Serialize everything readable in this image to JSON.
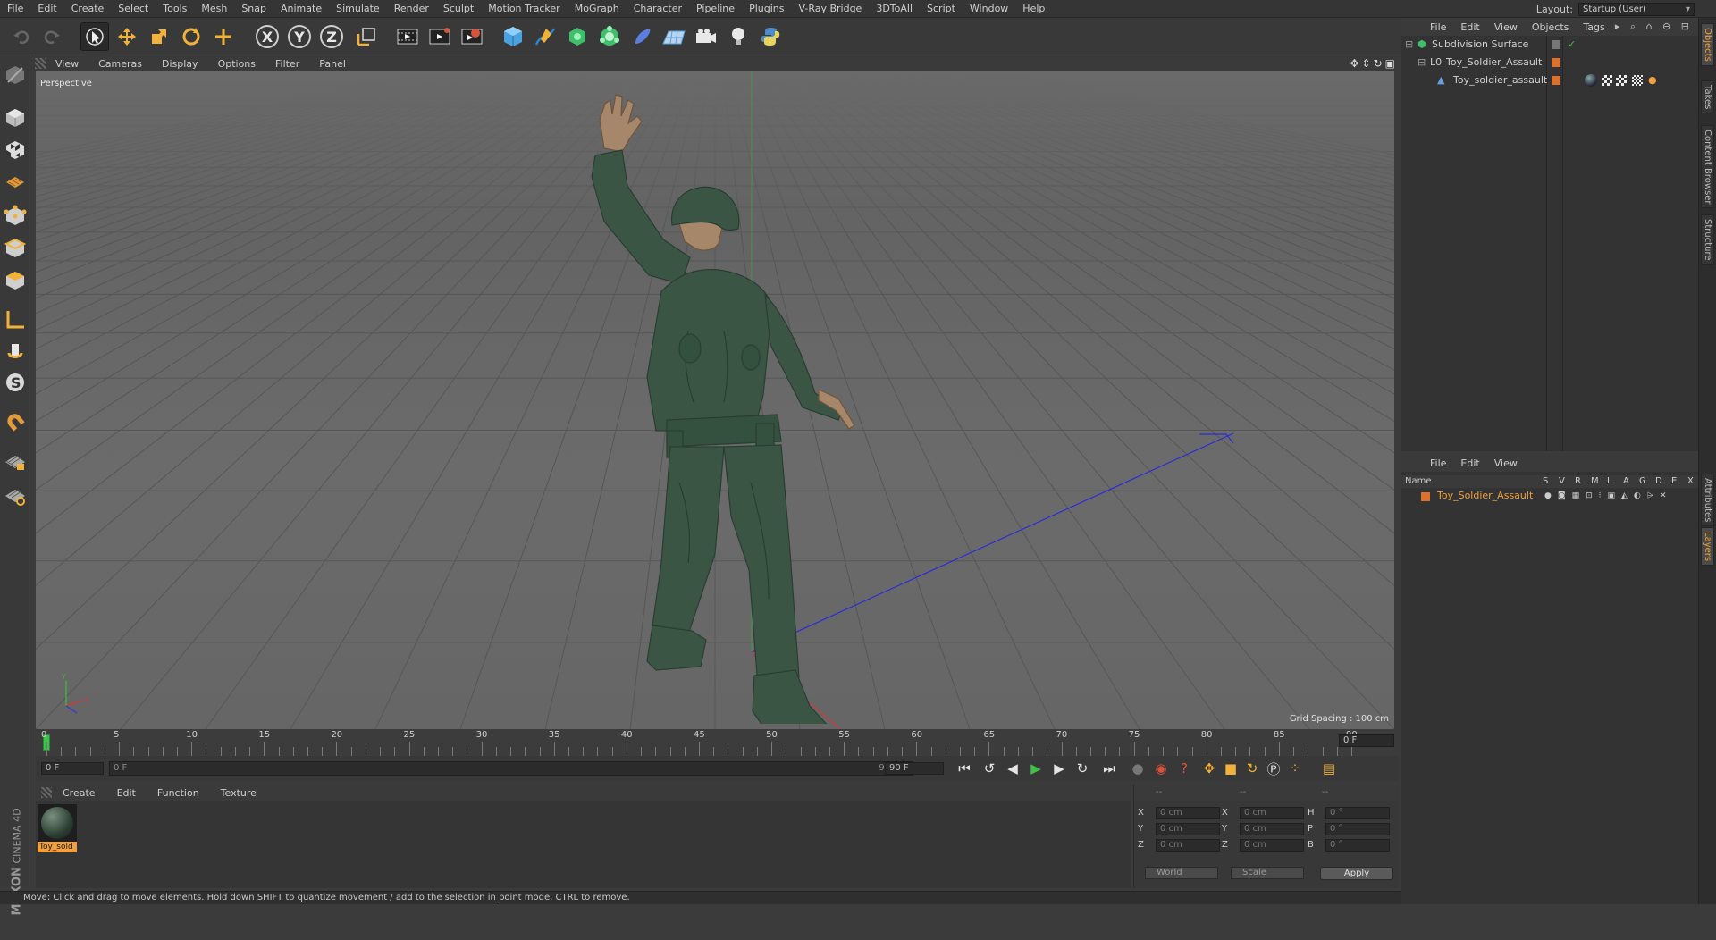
{
  "menubar": {
    "items": [
      "File",
      "Edit",
      "Create",
      "Select",
      "Tools",
      "Mesh",
      "Snap",
      "Animate",
      "Simulate",
      "Render",
      "Sculpt",
      "Motion Tracker",
      "MoGraph",
      "Character",
      "Pipeline",
      "Plugins",
      "V-Ray Bridge",
      "3DToAll",
      "Script",
      "Window",
      "Help"
    ],
    "layout_label": "Layout:",
    "layout_value": "Startup (User)"
  },
  "viewport": {
    "menu": [
      "View",
      "Cameras",
      "Display",
      "Options",
      "Filter",
      "Panel"
    ],
    "label": "Perspective",
    "grid_spacing": "Grid Spacing : 100 cm"
  },
  "timeline": {
    "ticks": [
      "0",
      "5",
      "10",
      "15",
      "20",
      "25",
      "30",
      "35",
      "40",
      "45",
      "50",
      "55",
      "60",
      "65",
      "70",
      "75",
      "80",
      "85",
      "90"
    ],
    "current_frame": "0 F"
  },
  "transport": {
    "start_field": "0 F",
    "range_start": "0 F",
    "range_end": "90 F",
    "end_field": "90 F"
  },
  "material_manager": {
    "menu": [
      "Create",
      "Edit",
      "Function",
      "Texture"
    ],
    "material_name": "Toy_sold"
  },
  "coordinates": {
    "headers": [
      "--",
      "--",
      "--"
    ],
    "rows": [
      {
        "a": "X",
        "av": "0 cm",
        "b": "X",
        "bv": "0 cm",
        "c": "H",
        "cv": "0 °"
      },
      {
        "a": "Y",
        "av": "0 cm",
        "b": "Y",
        "bv": "0 cm",
        "c": "P",
        "cv": "0 °"
      },
      {
        "a": "Z",
        "av": "0 cm",
        "b": "Z",
        "bv": "0 cm",
        "c": "B",
        "cv": "0 °"
      }
    ],
    "mode": "World",
    "scale": "Scale",
    "apply": "Apply"
  },
  "object_manager": {
    "menu": [
      "File",
      "Edit",
      "View",
      "Objects",
      "Tags"
    ],
    "objects": [
      {
        "name": "Subdivision Surface",
        "level": 0
      },
      {
        "name": "Toy_Soldier_Assault",
        "level": 1
      },
      {
        "name": "Toy_soldier_assault",
        "level": 2
      }
    ]
  },
  "layer_manager": {
    "menu": [
      "File",
      "Edit",
      "View"
    ],
    "header_name": "Name",
    "columns": [
      "S",
      "V",
      "R",
      "M",
      "L",
      "A",
      "G",
      "D",
      "E",
      "X"
    ],
    "layer_name": "Toy_Soldier_Assault"
  },
  "side_tabs": [
    "Objects",
    "Takes",
    "Content Browser",
    "Structure",
    "Attributes",
    "Layers"
  ],
  "status": "Move: Click and drag to move elements. Hold down SHIFT to quantize movement / add to the selection in point mode, CTRL to remove.",
  "brand": {
    "line1": "MAXON",
    "line2": "CINEMA 4D"
  },
  "colors": {
    "accent": "#f0a040",
    "x_axis": "#c83c3c",
    "z_axis": "#3c3cc8",
    "y_axis": "#3cb43c",
    "soldier": "#3b5545"
  }
}
